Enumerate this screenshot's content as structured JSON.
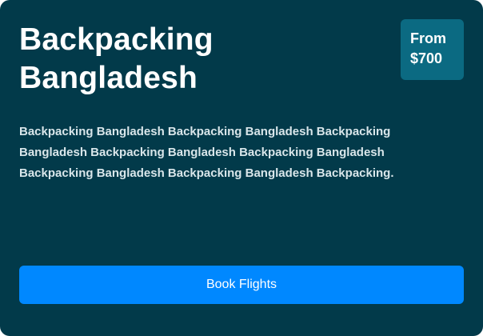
{
  "card": {
    "title": "Backpacking Bangladesh",
    "price": {
      "prefix": "From",
      "amount": "$700"
    },
    "description": "Backpacking Bangladesh Backpacking Bangladesh Backpacking Bangladesh Backpacking Bangladesh Backpacking Bangladesh Backpacking Bangladesh Backpacking Bangladesh Backpacking.",
    "button_label": "Book Flights"
  },
  "colors": {
    "card_background": "#023a4a",
    "badge_background": "#0b6a82",
    "button_background": "#0088ff",
    "text_primary": "#ffffff",
    "text_secondary": "#d9e6ea"
  }
}
